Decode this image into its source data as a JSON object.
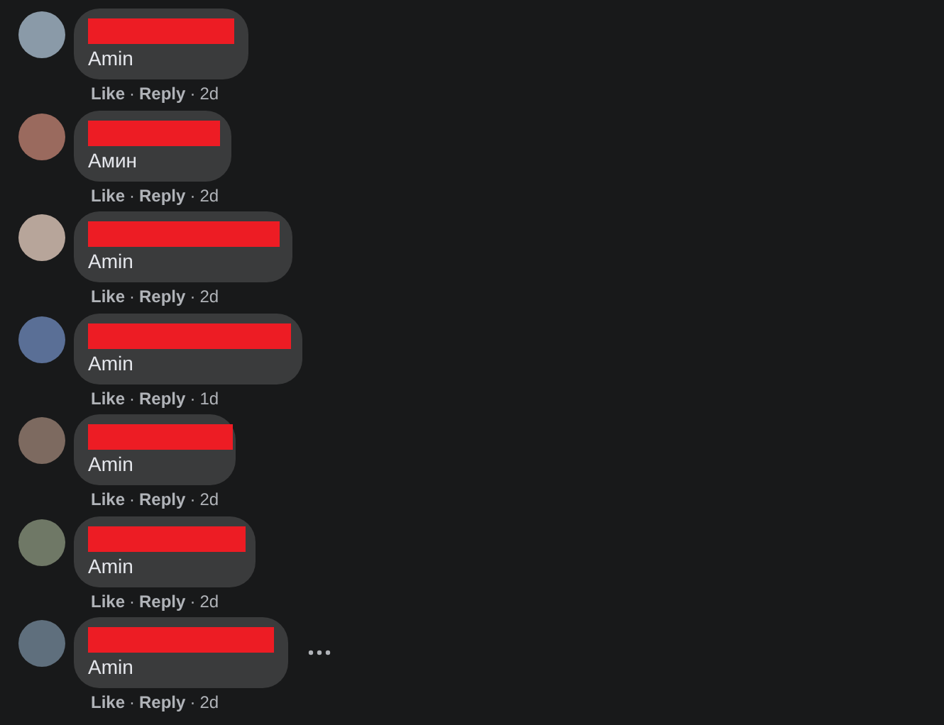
{
  "comments": [
    {
      "text": "Amin",
      "like": "Like",
      "dot1": "·",
      "reply": "Reply",
      "dot2": "·",
      "time": "2d",
      "more_shown": false
    },
    {
      "text": "Амин",
      "like": "Like",
      "dot1": "·",
      "reply": "Reply",
      "dot2": "·",
      "time": "2d",
      "more_shown": false
    },
    {
      "text": "Amin",
      "like": "Like",
      "dot1": "·",
      "reply": "Reply",
      "dot2": "·",
      "time": "2d",
      "more_shown": false
    },
    {
      "text": "Amin",
      "like": "Like",
      "dot1": "·",
      "reply": "Reply",
      "dot2": "·",
      "time": "1d",
      "more_shown": false
    },
    {
      "text": "Amin",
      "like": "Like",
      "dot1": "·",
      "reply": "Reply",
      "dot2": "·",
      "time": "2d",
      "more_shown": false
    },
    {
      "text": "Amin",
      "like": "Like",
      "dot1": "·",
      "reply": "Reply",
      "dot2": "·",
      "time": "2d",
      "more_shown": false
    },
    {
      "text": "Amin",
      "like": "Like",
      "dot1": "·",
      "reply": "Reply",
      "dot2": "·",
      "time": "2d",
      "more_shown": true
    }
  ]
}
